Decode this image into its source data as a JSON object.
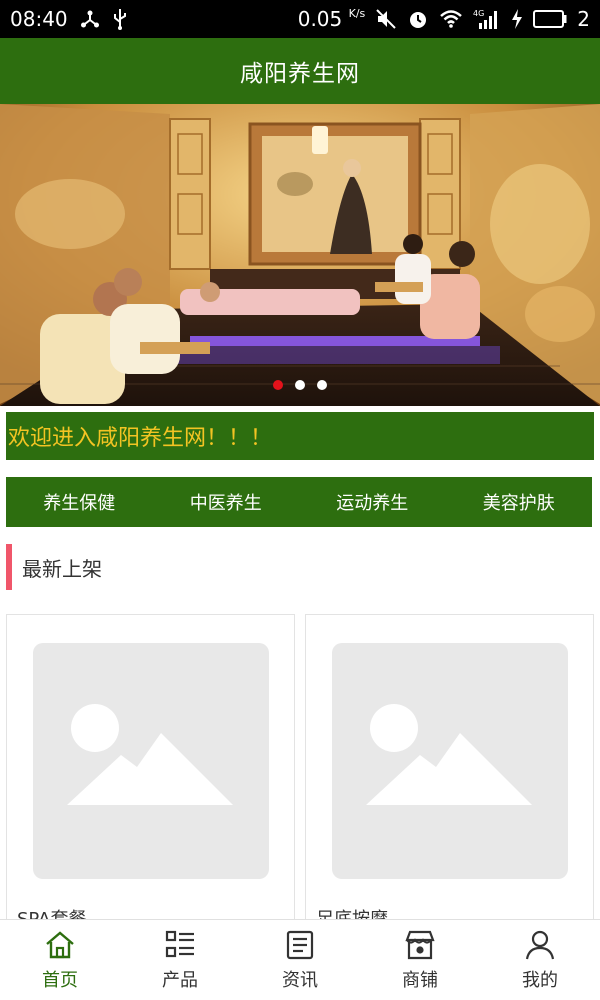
{
  "status_bar": {
    "time": "08:40",
    "net_speed": "0.05",
    "net_speed_unit": "K/s",
    "network_label": "4G",
    "battery_level": "2"
  },
  "header": {
    "title": "咸阳养生网"
  },
  "banner": {
    "slide_count": 3,
    "active_index": 0
  },
  "welcome": {
    "text": "欢迎进入咸阳养生网！！！"
  },
  "categories": [
    "养生保健",
    "中医养生",
    "运动养生",
    "美容护肤"
  ],
  "section": {
    "title": "最新上架"
  },
  "products": [
    {
      "name": "SPA套餐"
    },
    {
      "name": "足底按摩"
    }
  ],
  "bottom_nav": [
    {
      "label": "首页",
      "icon": "home-icon",
      "active": true
    },
    {
      "label": "产品",
      "icon": "list-icon",
      "active": false
    },
    {
      "label": "资讯",
      "icon": "news-icon",
      "active": false
    },
    {
      "label": "商铺",
      "icon": "store-icon",
      "active": false
    },
    {
      "label": "我的",
      "icon": "user-icon",
      "active": false
    }
  ],
  "colors": {
    "brand_green": "#2d6e0f",
    "welcome_text": "#f3c423",
    "accent_pink": "#f0566a",
    "active_dot": "#e3121b"
  }
}
